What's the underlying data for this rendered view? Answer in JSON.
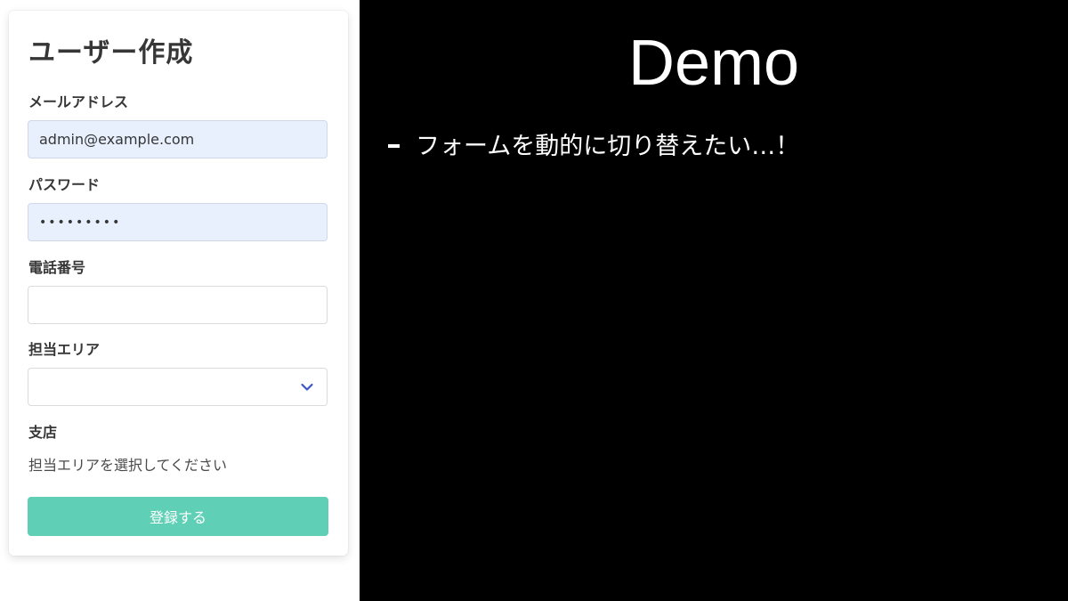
{
  "form": {
    "title": "ユーザー作成",
    "email": {
      "label": "メールアドレス",
      "value": "admin@example.com"
    },
    "password": {
      "label": "パスワード",
      "value": "•••••••••"
    },
    "phone": {
      "label": "電話番号",
      "value": ""
    },
    "area": {
      "label": "担当エリア",
      "selected": ""
    },
    "branch": {
      "label": "支店",
      "help": "担当エリアを選択してください"
    },
    "submit_label": "登録する",
    "colors": {
      "submit": "#5fd0b5",
      "autofill": "#e8f0fe",
      "chevron": "#3e56c4"
    },
    "icons": {
      "select": "chevron-down-icon"
    }
  },
  "slide": {
    "title": "Demo",
    "bullets": [
      "フォームを動的に切り替えたい…！"
    ],
    "background": "#000000"
  }
}
